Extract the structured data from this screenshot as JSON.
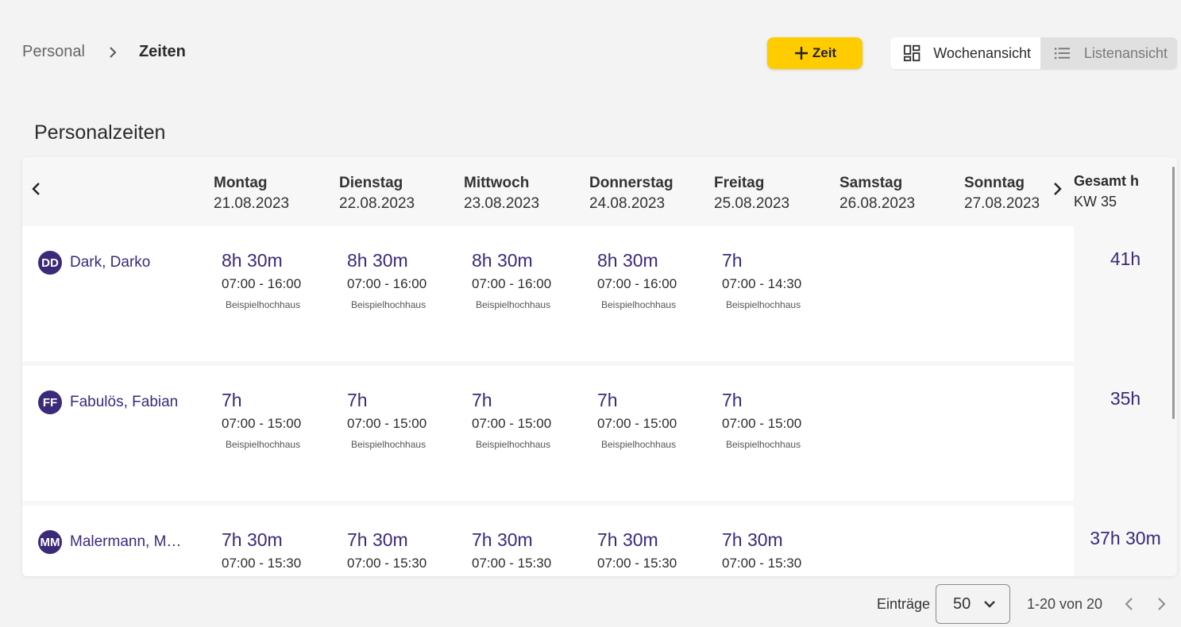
{
  "breadcrumb": {
    "parent": "Personal",
    "current": "Zeiten"
  },
  "toolbar": {
    "add_label": "Zeit",
    "week_view_label": "Wochenansicht",
    "list_view_label": "Listenansicht"
  },
  "section_title": "Personalzeiten",
  "week": {
    "days": [
      {
        "name": "Montag",
        "date": "21.08.2023"
      },
      {
        "name": "Dienstag",
        "date": "22.08.2023"
      },
      {
        "name": "Mittwoch",
        "date": "23.08.2023"
      },
      {
        "name": "Donnerstag",
        "date": "24.08.2023"
      },
      {
        "name": "Freitag",
        "date": "25.08.2023"
      },
      {
        "name": "Samstag",
        "date": "26.08.2023"
      },
      {
        "name": "Sonntag",
        "date": "27.08.2023"
      }
    ],
    "total_header": "Gesamt h",
    "week_label": "KW 35"
  },
  "employees": [
    {
      "initials": "DD",
      "name": "Dark, Darko",
      "total": "41h",
      "entries": [
        {
          "duration": "8h 30m",
          "range": "07:00 - 16:00",
          "location": "Beispielhochhaus"
        },
        {
          "duration": "8h 30m",
          "range": "07:00 - 16:00",
          "location": "Beispielhochhaus"
        },
        {
          "duration": "8h 30m",
          "range": "07:00 - 16:00",
          "location": "Beispielhochhaus"
        },
        {
          "duration": "8h 30m",
          "range": "07:00 - 16:00",
          "location": "Beispielhochhaus"
        },
        {
          "duration": "7h",
          "range": "07:00 - 14:30",
          "location": "Beispielhochhaus"
        }
      ]
    },
    {
      "initials": "FF",
      "name": "Fabulös, Fabian",
      "total": "35h",
      "entries": [
        {
          "duration": "7h",
          "range": "07:00 - 15:00",
          "location": "Beispielhochhaus"
        },
        {
          "duration": "7h",
          "range": "07:00 - 15:00",
          "location": "Beispielhochhaus"
        },
        {
          "duration": "7h",
          "range": "07:00 - 15:00",
          "location": "Beispielhochhaus"
        },
        {
          "duration": "7h",
          "range": "07:00 - 15:00",
          "location": "Beispielhochhaus"
        },
        {
          "duration": "7h",
          "range": "07:00 - 15:00",
          "location": "Beispielhochhaus"
        }
      ]
    },
    {
      "initials": "MM",
      "name": "Malermann, M…",
      "total": "37h 30m",
      "entries": [
        {
          "duration": "7h 30m",
          "range": "07:00 - 15:30",
          "location": ""
        },
        {
          "duration": "7h 30m",
          "range": "07:00 - 15:30",
          "location": ""
        },
        {
          "duration": "7h 30m",
          "range": "07:00 - 15:30",
          "location": ""
        },
        {
          "duration": "7h 30m",
          "range": "07:00 - 15:30",
          "location": ""
        },
        {
          "duration": "7h 30m",
          "range": "07:00 - 15:30",
          "location": ""
        }
      ]
    }
  ],
  "pagination": {
    "label": "Einträge",
    "page_size": "50",
    "range": "1-20 von 20"
  },
  "icons": {
    "breadcrumb_separator": "chevron-right-icon",
    "add": "plus-icon",
    "week_view": "dashboard-grid-icon",
    "list_view": "list-icon",
    "week_prev": "chevron-left-icon",
    "week_next": "chevron-right-icon",
    "select": "chevron-down-icon"
  },
  "colors": {
    "accent": "#ffcc00",
    "primary": "#3b2a7a"
  }
}
